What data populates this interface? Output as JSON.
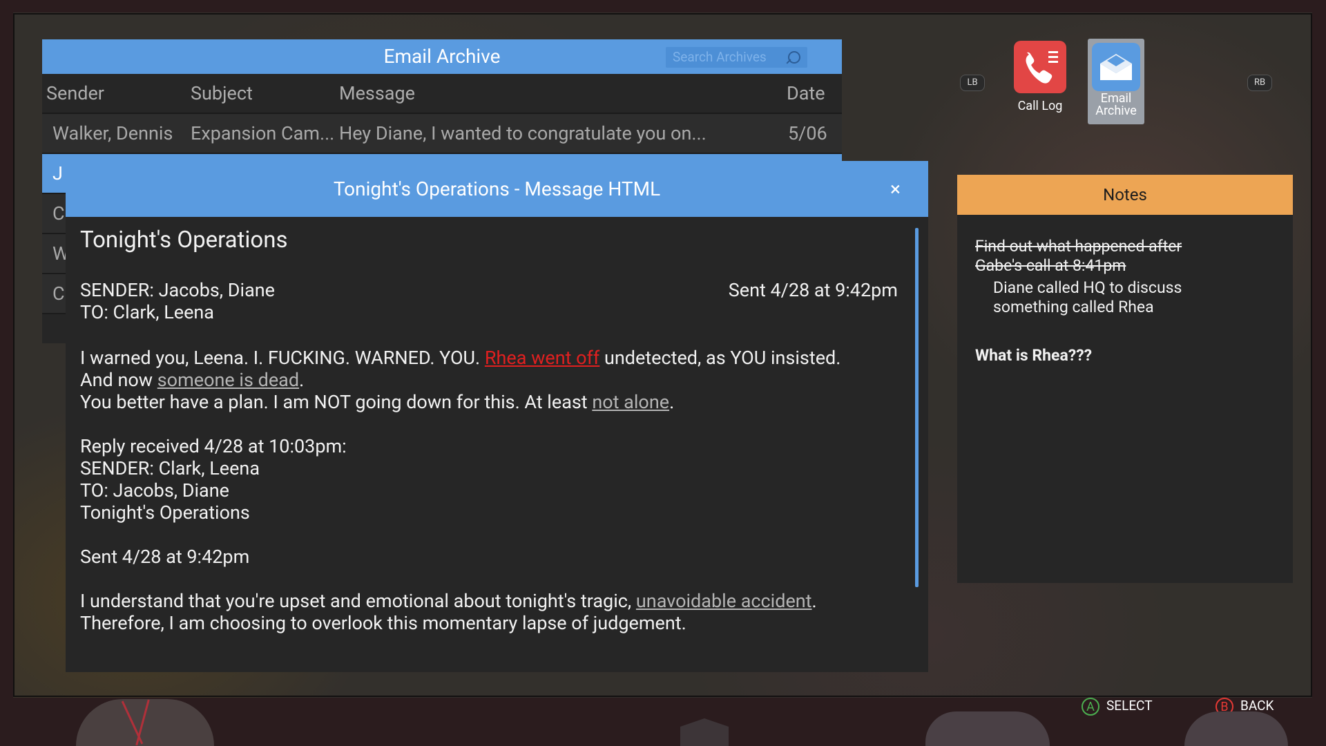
{
  "archive": {
    "title": "Email Archive",
    "search_placeholder": "Search Archives",
    "columns": {
      "sender": "Sender",
      "subject": "Subject",
      "message": "Message",
      "date": "Date"
    },
    "rows": [
      {
        "sender": "Walker, Dennis",
        "subject": "Expansion Cam...",
        "message": "Hey Diane, I wanted to congratulate you on...",
        "date": "5/06"
      },
      {
        "sender": "J",
        "subject": "",
        "message": "",
        "date": ""
      },
      {
        "sender": "C",
        "subject": "",
        "message": "",
        "date": ""
      },
      {
        "sender": "W",
        "subject": "",
        "message": "",
        "date": ""
      },
      {
        "sender": "C",
        "subject": "",
        "message": "",
        "date": ""
      }
    ]
  },
  "modal": {
    "title": "Tonight's Operations - Message HTML",
    "close": "×",
    "subject": "Tonight's Operations",
    "sender_line": "SENDER: Jacobs, Diane",
    "sent_line": "Sent 4/28 at 9:42pm",
    "to_line": "TO: Clark, Leena",
    "p1_a": "I warned you, Leena. I. FUCKING. WARNED. YOU. ",
    "p1_link": "Rhea went off",
    "p1_b": " undetected, as YOU insisted.",
    "p2_a": "And now ",
    "p2_link": "someone is dead",
    "p2_b": ".",
    "p3_a": "You better have a plan. I am NOT going down for this. At least ",
    "p3_link": "not alone",
    "p3_b": ".",
    "reply_received": "Reply received 4/28 at 10:03pm:",
    "reply_sender": "SENDER: Clark, Leena",
    "reply_to": "TO: Jacobs, Diane",
    "reply_subject": "Tonight's Operations",
    "reply_sent": "Sent 4/28 at 9:42pm",
    "r1_a": "I understand that you're upset and emotional about tonight's tragic, ",
    "r1_link": "unavoidable accident",
    "r1_b": ".",
    "r2": "Therefore, I am choosing to overlook this momentary lapse of judgement."
  },
  "apps": {
    "lb": "LB",
    "rb": "RB",
    "call_log": "Call Log",
    "email_archive_1": "Email",
    "email_archive_2": "Archive"
  },
  "notes": {
    "title": "Notes",
    "struck": "Find out what happened after Gabe's call at 8:41pm",
    "sub": "Diane called HQ to discuss something called Rhea",
    "question": "What is Rhea???"
  },
  "controls": {
    "select_btn": "A",
    "select": "SELECT",
    "back_btn": "B",
    "back": "BACK"
  },
  "colors": {
    "accent_blue": "#5a9be0",
    "notes_orange": "#eda554",
    "call_red": "#e24645",
    "link_red": "#e02020"
  }
}
